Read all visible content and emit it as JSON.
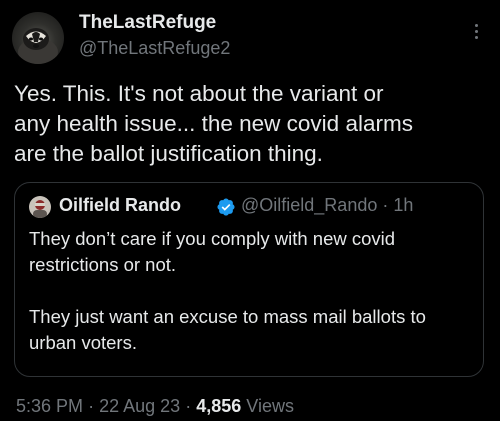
{
  "author": {
    "display_name": "TheLastRefuge",
    "handle": "@TheLastRefuge2"
  },
  "tweet": {
    "text": "Yes. This.  It's not about the variant or\nany health issue... the new covid alarms\nare the ballot justification thing."
  },
  "quoted_tweet": {
    "display_name": "Oilfield Rando",
    "handle": "@Oilfield_Rando",
    "separator": "·",
    "time_ago": "1h",
    "paragraphs": [
      "They don’t care if you comply with new covid restrictions or not.",
      "They just want an excuse to mass mail ballots to urban voters."
    ]
  },
  "footer": {
    "time": "5:36 PM",
    "date": "22 Aug 23",
    "separator": "·",
    "view_count": "4,856",
    "views_label": "Views"
  },
  "colors": {
    "background": "#000000",
    "primary_text": "#e7e9ea",
    "secondary_text": "#71767b",
    "border": "#2f3336",
    "verified": "#1d9bf0"
  },
  "icons": [
    "avatar-badger",
    "more-options-icon",
    "verified-badge-icon"
  ]
}
